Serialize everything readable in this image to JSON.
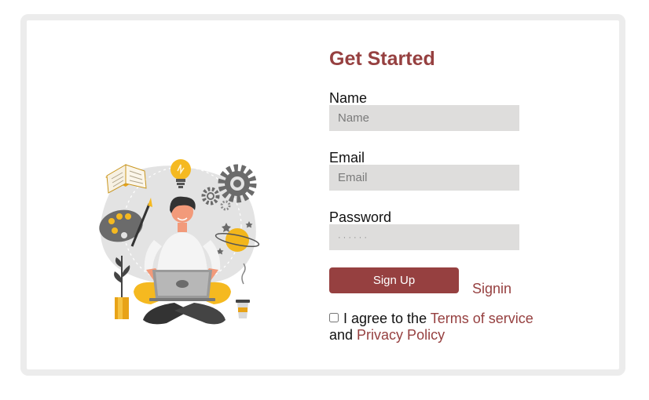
{
  "colors": {
    "accent": "#964040",
    "input_bg": "#dedddc",
    "card_border": "#ececec"
  },
  "illustration": {
    "name": "person-with-laptop-creative-ideas"
  },
  "form": {
    "title": "Get Started",
    "name": {
      "label": "Name",
      "placeholder": "Name"
    },
    "email": {
      "label": "Email",
      "placeholder": "Email"
    },
    "password": {
      "label": "Password",
      "placeholder": "······"
    },
    "signup_button": "Sign Up",
    "signin_link": "Signin",
    "agree": {
      "prefix": "I agree to the ",
      "terms_link": "Terms of service",
      "middle": "and ",
      "privacy_link": "Privacy Policy"
    }
  }
}
